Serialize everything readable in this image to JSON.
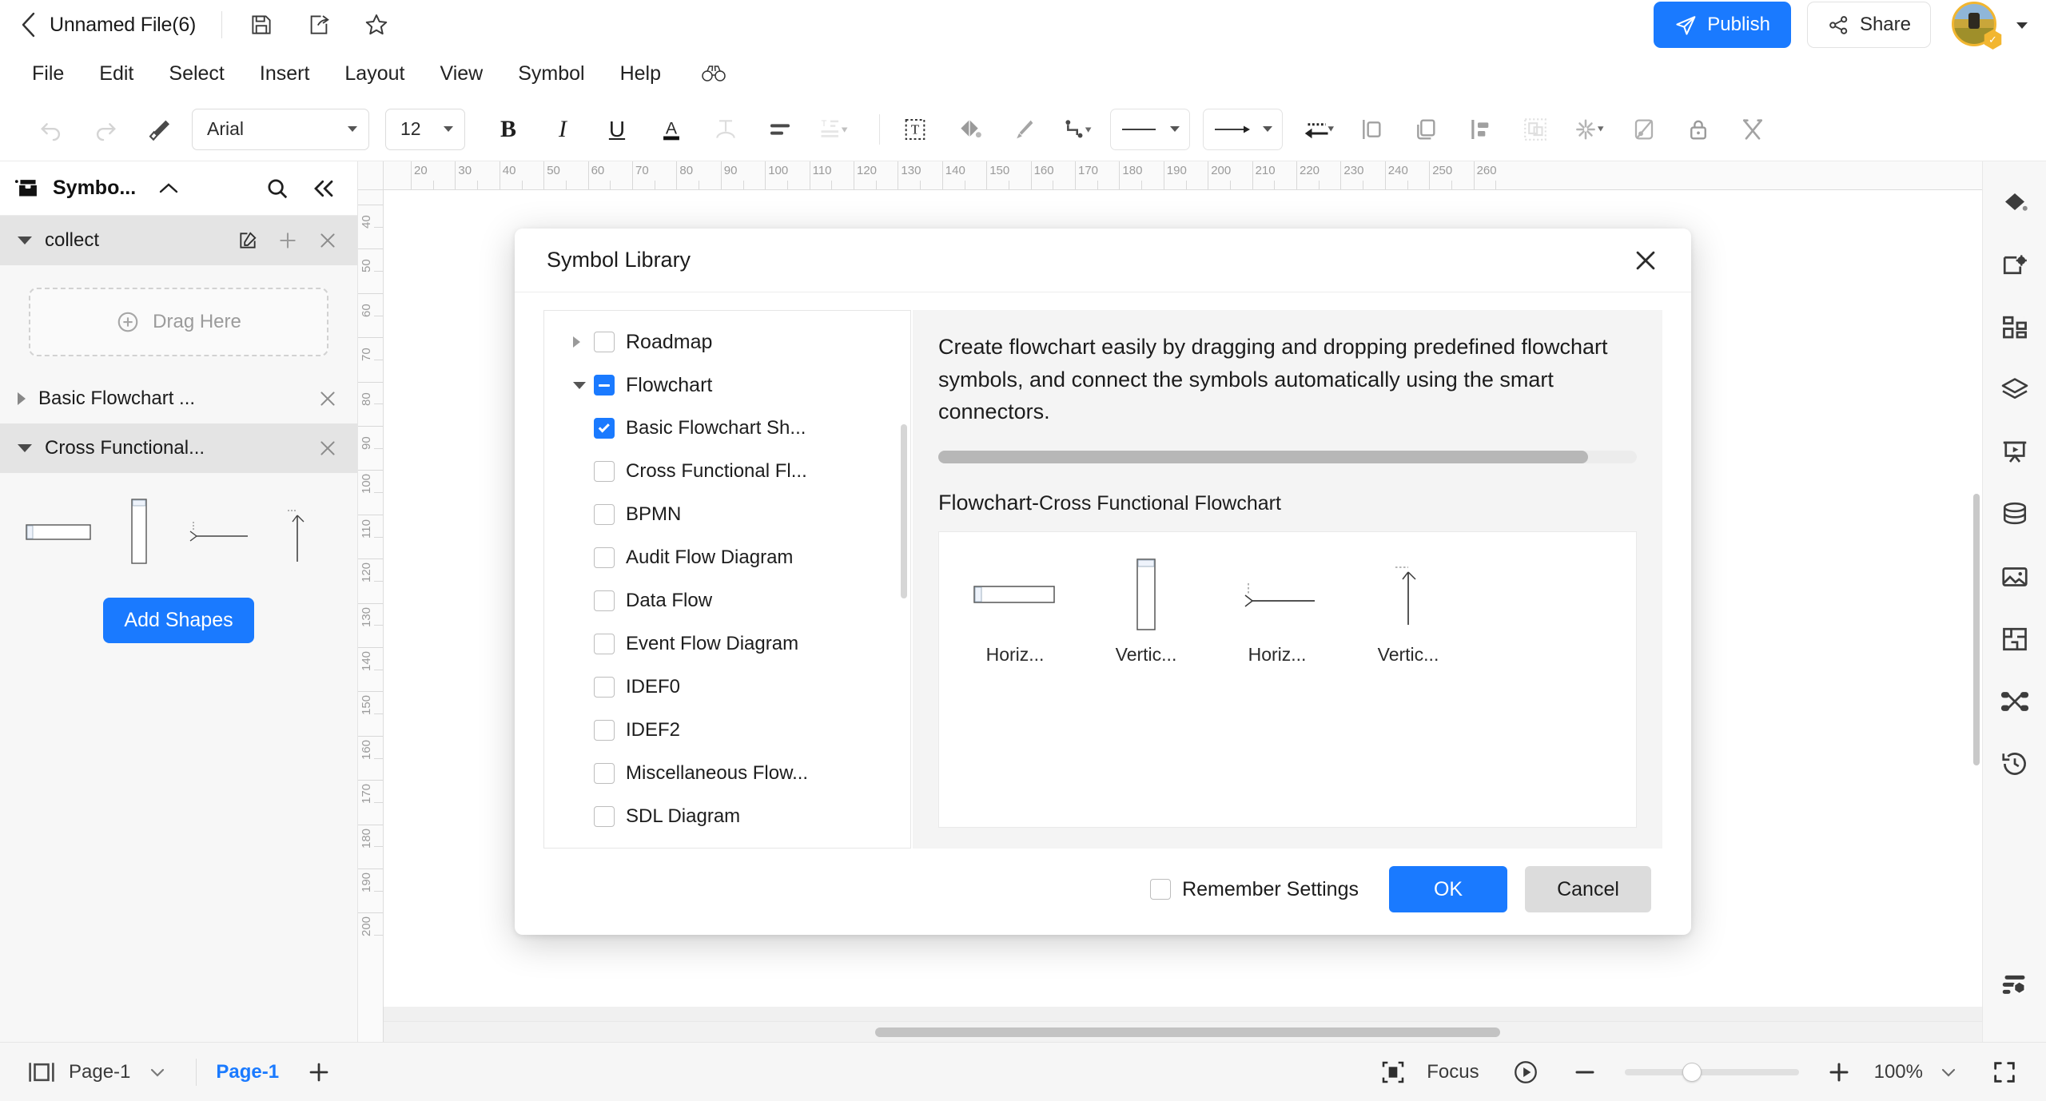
{
  "titlebar": {
    "back_icon": "back-chevron-icon",
    "doc_title": "Unnamed File(6)",
    "save_icon": "save-icon",
    "export_icon": "export-icon",
    "favorite_icon": "star-icon",
    "publish_label": "Publish",
    "share_label": "Share",
    "avatar_badge": "✓",
    "account_caret": "▾"
  },
  "menubar": {
    "items": [
      {
        "label": "File"
      },
      {
        "label": "Edit"
      },
      {
        "label": "Select"
      },
      {
        "label": "Insert"
      },
      {
        "label": "Layout"
      },
      {
        "label": "View"
      },
      {
        "label": "Symbol"
      },
      {
        "label": "Help"
      }
    ],
    "binoculars_icon": "binoculars-icon"
  },
  "toolbar": {
    "undo_icon": "undo-icon",
    "redo_icon": "redo-icon",
    "format_painter_icon": "format-painter-icon",
    "font_family": "Arial",
    "font_size": "12",
    "bold_label": "B",
    "italic_label": "I",
    "underline_label": "U",
    "font_color_label": "A",
    "text_effect_icon": "text-arc-icon",
    "align_icon": "align-left-icon",
    "paragraph_icon": "paragraph-spacing-icon",
    "text_box_icon": "text-box-icon",
    "fill_icon": "fill-color-icon",
    "brush_icon": "brush-icon",
    "connector_icon": "connector-icon",
    "line_style_value": "solid-line",
    "arrow_style_value": "arrow-line",
    "dash_style_icon": "dashed-arrow-icon",
    "align_objects_icon": "align-objects-icon",
    "arrange_icon": "arrange-icon",
    "distribute_icon": "distribute-icon",
    "group_icon": "group-icon",
    "effects_icon": "effects-icon",
    "theme_icon": "theme-icon",
    "lock_icon": "lock-icon",
    "tools_icon": "tools-icon"
  },
  "left_panel": {
    "header_icon": "symbol-library-icon",
    "title": "Symbo...",
    "collapse_icon": "chevron-up-icon",
    "search_icon": "search-icon",
    "collapse_panel_icon": "double-chevron-left-icon",
    "groups": [
      {
        "title": "collect",
        "expanded": true,
        "selected": true,
        "edit_icon": "edit-icon",
        "add_icon": "plus-icon",
        "close_icon": "close-icon",
        "drop_zone_label": "Drag Here"
      },
      {
        "title": "Basic Flowchart ...",
        "expanded": false,
        "selected": false,
        "close_icon": "close-icon"
      },
      {
        "title": "Cross Functional...",
        "expanded": true,
        "selected": true,
        "close_icon": "close-icon",
        "shapes": [
          {
            "name": "horizontal-swimlane-shape"
          },
          {
            "name": "vertical-swimlane-shape"
          },
          {
            "name": "horizontal-separator-shape"
          },
          {
            "name": "vertical-separator-shape"
          }
        ]
      }
    ],
    "add_shapes_label": "Add Shapes"
  },
  "canvas": {
    "ruler_h_labels": [
      "20",
      "30",
      "40",
      "50",
      "60",
      "70",
      "80",
      "90",
      "100",
      "110",
      "120",
      "130",
      "140",
      "150",
      "160",
      "170",
      "180",
      "190",
      "200",
      "210",
      "220",
      "230",
      "240",
      "250",
      "260"
    ],
    "ruler_v_labels": [
      "40",
      "50",
      "60",
      "70",
      "80",
      "90",
      "100",
      "110",
      "120",
      "130",
      "140",
      "150",
      "160",
      "170",
      "180",
      "190",
      "200"
    ]
  },
  "right_rail": {
    "items": [
      {
        "icon": "fill-format-icon"
      },
      {
        "icon": "page-setup-icon"
      },
      {
        "icon": "apps-grid-icon"
      },
      {
        "icon": "layers-icon"
      },
      {
        "icon": "presentation-icon"
      },
      {
        "icon": "database-icon"
      },
      {
        "icon": "image-icon"
      },
      {
        "icon": "floorplan-icon"
      },
      {
        "icon": "mindmap-icon"
      },
      {
        "icon": "history-icon"
      }
    ],
    "bottom_item": {
      "icon": "settings-sliders-icon"
    }
  },
  "statusbar": {
    "panel_toggle_icon": "panel-toggle-icon",
    "page_selector_label": "Page-1",
    "page_selector_caret": "chevron-down-icon",
    "active_tab_label": "Page-1",
    "add_page_icon": "plus-icon",
    "focus_icon": "focus-icon",
    "focus_label": "Focus",
    "present_icon": "play-circle-icon",
    "zoom_out_icon": "minus-icon",
    "zoom_in_icon": "plus-icon",
    "zoom_value": "100%",
    "zoom_caret": "chevron-down-icon",
    "fullscreen_icon": "fullscreen-icon"
  },
  "modal": {
    "title": "Symbol Library",
    "close_icon": "close-icon",
    "tree": [
      {
        "label": "Roadmap",
        "level": 0,
        "state": "unchecked",
        "arrow": "collapsed"
      },
      {
        "label": "Flowchart",
        "level": 0,
        "state": "indeterminate",
        "arrow": "expanded"
      },
      {
        "label": "Basic Flowchart Sh...",
        "level": 1,
        "state": "checked",
        "arrow": "none"
      },
      {
        "label": "Cross Functional Fl...",
        "level": 1,
        "state": "unchecked",
        "arrow": "none"
      },
      {
        "label": "BPMN",
        "level": 1,
        "state": "unchecked",
        "arrow": "none"
      },
      {
        "label": "Audit Flow Diagram",
        "level": 1,
        "state": "unchecked",
        "arrow": "none"
      },
      {
        "label": "Data Flow",
        "level": 1,
        "state": "unchecked",
        "arrow": "none"
      },
      {
        "label": "Event Flow Diagram",
        "level": 1,
        "state": "unchecked",
        "arrow": "none"
      },
      {
        "label": "IDEF0",
        "level": 1,
        "state": "unchecked",
        "arrow": "none"
      },
      {
        "label": "IDEF2",
        "level": 1,
        "state": "unchecked",
        "arrow": "none"
      },
      {
        "label": "Miscellaneous Flow...",
        "level": 1,
        "state": "unchecked",
        "arrow": "none"
      },
      {
        "label": "SDL Diagram",
        "level": 1,
        "state": "unchecked",
        "arrow": "none"
      }
    ],
    "description": "Create flowchart easily by dragging and dropping predefined flowchart symbols, and connect the symbols automatically using the smart connectors.",
    "subtitle_lead": "Flowchart-",
    "subtitle_rest": "Cross Functional Flowchart",
    "shapes": [
      {
        "label": "Horiz...",
        "art": "horizontal-swimlane-shape"
      },
      {
        "label": "Vertic...",
        "art": "vertical-swimlane-shape"
      },
      {
        "label": "Horiz...",
        "art": "horizontal-separator-shape"
      },
      {
        "label": "Vertic...",
        "art": "vertical-separator-shape"
      }
    ],
    "remember_label": "Remember Settings",
    "remember_checked": false,
    "ok_label": "OK",
    "cancel_label": "Cancel"
  },
  "colors": {
    "accent": "#1a7aff",
    "panel_bg": "#f7f7f7",
    "selected_row": "#e4e4e4",
    "avatar_ring": "#f2b630"
  }
}
